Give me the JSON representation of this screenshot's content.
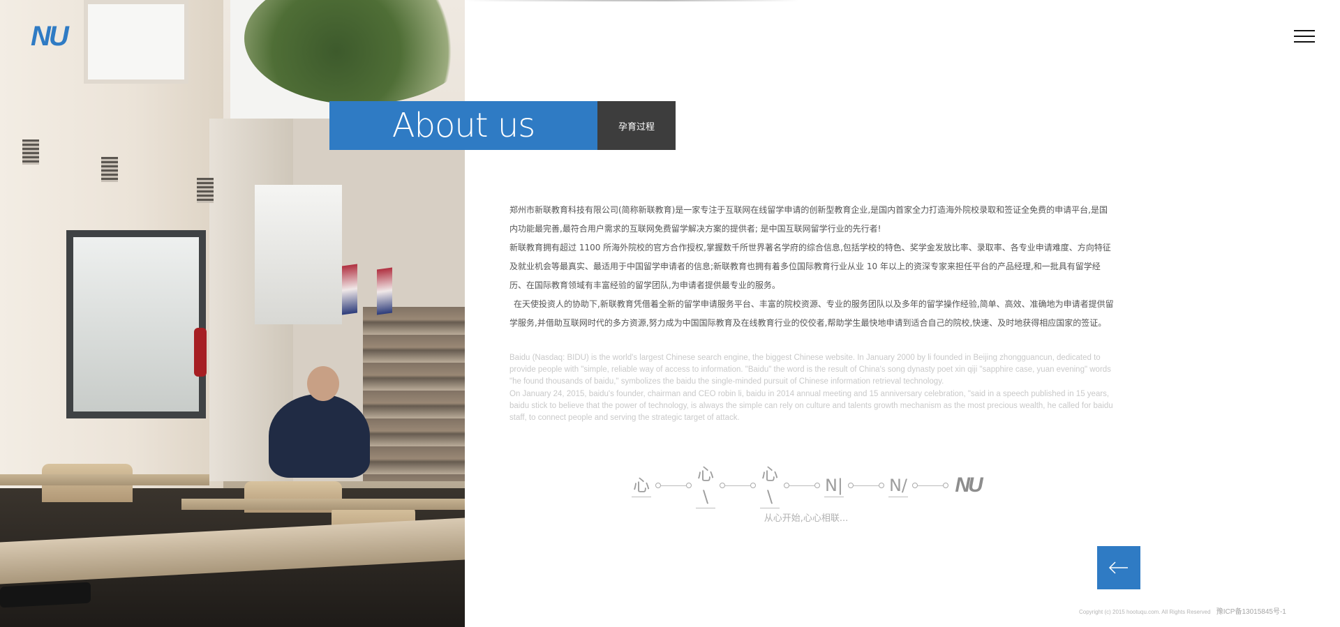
{
  "brand": {
    "logo_text": "NU",
    "accent_color": "#2f7bc4"
  },
  "header": {
    "menu_icon": "hamburger-menu-icon"
  },
  "section": {
    "title": "About us",
    "tag": "孕育过程"
  },
  "intro_cn": [
    "郑州市新联教育科技有限公司(简称新联教育)是一家专注于互联网在线留学申请的创新型教育企业,是国内首家全力打造海外院校录取和签证全免费的申请平台,是国内功能最完善,最符合用户需求的互联网免费留学解决方案的提供者; 是中国互联网留学行业的先行者!",
    "新联教育拥有超过 1100 所海外院校的官方合作授权,掌握数千所世界著名学府的综合信息,包括学校的特色、奖学金发放比率、录取率、各专业申请难度、方向特征及就业机会等最真实、最适用于中国留学申请者的信息;新联教育也拥有着多位国际教育行业从业 10 年以上的资深专家来担任平台的产品经理,和一批具有留学经历、在国际教育领域有丰富经验的留学团队,为申请者提供最专业的服务。",
    "在天使投资人的协助下,新联教育凭借着全新的留学申请服务平台、丰富的院校资源、专业的服务团队以及多年的留学操作经验,简单、高效、准确地为申请者提供留学服务,并借助互联网时代的多方资源,努力成为中国国际教育及在线教育行业的佼佼者,帮助学生最快地申请到适合自己的院校,快速、及时地获得相应国家的签证。"
  ],
  "intro_en": [
    "Baidu (Nasdaq: BIDU) is the world's largest Chinese search engine, the biggest Chinese website. In January 2000 by li founded in Beijing zhongguancun, dedicated to provide people with \"simple, reliable way of access to information. \"Baidu\" the word is the result of China's song dynasty poet xin qiji \"sapphire case, yuan evening\" words \"he found thousands of baidu,\" symbolizes the baidu the single-minded pursuit of Chinese information retrieval technology.",
    "On January 24, 2015, baidu's founder, chairman and CEO robin li, baidu in 2014 annual meeting and 15 anniversary celebration, \"said in a speech published in 15 years, baidu stick to believe that the power of technology, is always the simple can rely on culture and talents growth mechanism as the most precious wealth, he called for baidu staff, to connect people and serving the strategic target of attack."
  ],
  "evolution": {
    "stages": [
      "心",
      "心\\",
      "心\\",
      "N|",
      "N/",
      "NU"
    ],
    "slogan": "从心开始,心心相联..."
  },
  "back_button": {
    "icon": "arrow-left-icon"
  },
  "footer": {
    "copyright": "Copyright (c) 2015 hootuqu.com. All Rights Reserved",
    "icp": "豫ICP备13015845号-1"
  }
}
